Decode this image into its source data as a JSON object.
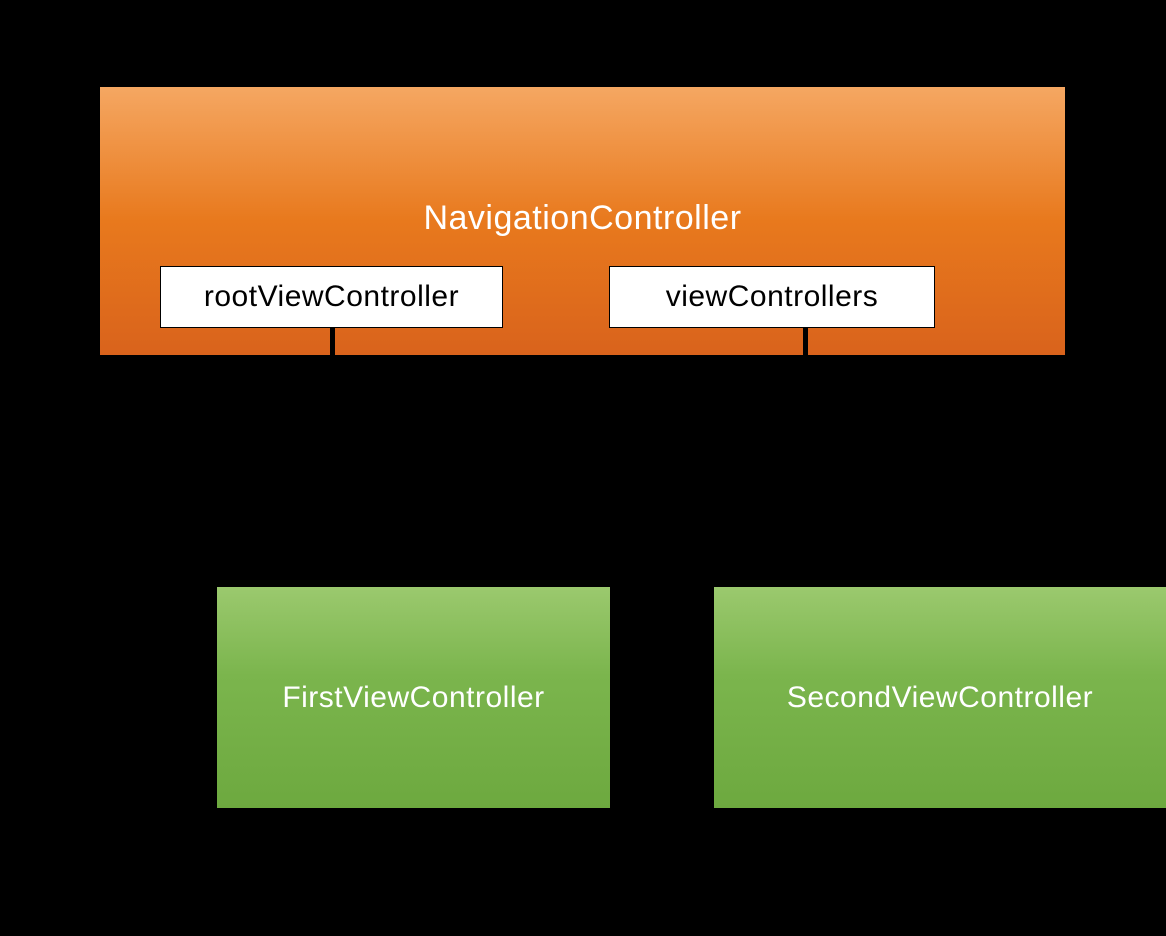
{
  "navController": {
    "title": "NavigationController",
    "properties": {
      "rootViewController": "rootViewController",
      "viewControllers": "viewControllers"
    }
  },
  "viewControllers": {
    "first": "FirstViewController",
    "second": "SecondViewController"
  }
}
